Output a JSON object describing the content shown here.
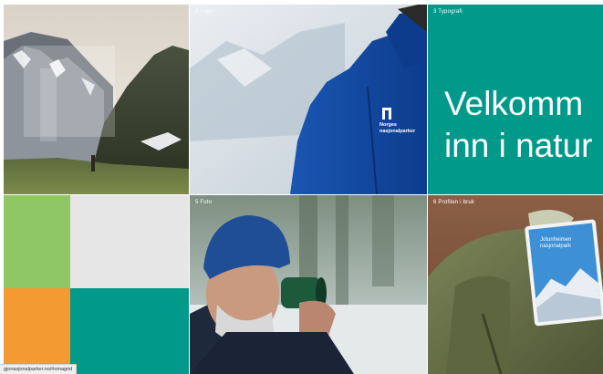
{
  "tiles": {
    "mountain": {
      "label": ""
    },
    "logo": {
      "label": "2 Logo",
      "brand_line1": "Norges",
      "brand_line2": "nasjonalparker"
    },
    "typography": {
      "label": "3 Typografi",
      "line1": "Velkomm",
      "line2": "inn i natur"
    },
    "photo": {
      "label": "5 Foto"
    },
    "profile": {
      "label": "6 Profilen i bruk",
      "book_line1": "Jotunheimen",
      "book_line2": "nasjonalpark"
    }
  },
  "status_bar": {
    "url": "gjonasjonalparker.no/#omagrid"
  },
  "colors": {
    "teal": "#00998a",
    "green": "#8fc767",
    "orange": "#f39a33",
    "light_gray": "#e6e6e6",
    "jacket_blue": "#1f5fc0"
  }
}
